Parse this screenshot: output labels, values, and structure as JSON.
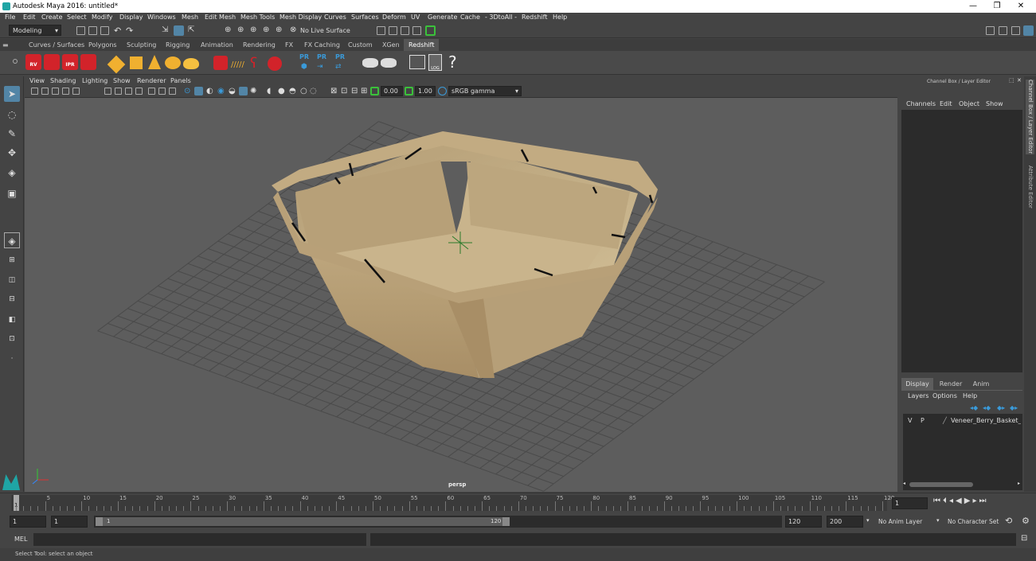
{
  "window": {
    "title": "Autodesk Maya 2016: untitled*",
    "minimize": "—",
    "restore": "❐",
    "close": "✕"
  },
  "menus": [
    "File",
    "Edit",
    "Create",
    "Select",
    "Modify",
    "Display",
    "Windows",
    "Mesh",
    "Edit Mesh",
    "Mesh Tools",
    "Mesh Display",
    "Curves",
    "Surfaces",
    "Deform",
    "UV",
    "Generate",
    "Cache",
    "- 3DtoAll -",
    "Redshift",
    "Help"
  ],
  "statusline": {
    "mode": "Modeling",
    "live_surface": "No Live Surface"
  },
  "shelf_tabs": [
    "Curves / Surfaces",
    "Polygons",
    "Sculpting",
    "Rigging",
    "Animation",
    "Rendering",
    "FX",
    "FX Caching",
    "Custom",
    "XGen",
    "Redshift"
  ],
  "shelf_active": "Redshift",
  "shelf_labels": {
    "rv": "RV",
    "ipr": "IPR",
    "pr": "PR",
    "log": "LOG",
    "help": "?"
  },
  "panel_menu": [
    "View",
    "Shading",
    "Lighting",
    "Show",
    "Renderer",
    "Panels"
  ],
  "panel_toolbar": {
    "exposure": "0.00",
    "gamma": "1.00",
    "colorspace": "sRGB gamma"
  },
  "viewport": {
    "camera_label": "persp"
  },
  "channel_box": {
    "title": "Channel Box / Layer Editor",
    "menus": [
      "Channels",
      "Edit",
      "Object",
      "Show"
    ],
    "layer_tabs": [
      "Display",
      "Render",
      "Anim"
    ],
    "layer_tab_active": "Display",
    "layer_menus": [
      "Layers",
      "Options",
      "Help"
    ],
    "layer_row": {
      "v": "V",
      "p": "P",
      "name": "Veneer_Berry_Basket_Squ"
    }
  },
  "side_tabs": [
    "Channel Box / Layer Editor",
    "Attribute Editor"
  ],
  "timeline": {
    "ticks": [
      "5",
      "10",
      "15",
      "20",
      "25",
      "30",
      "35",
      "40",
      "45",
      "50",
      "55",
      "60",
      "65",
      "70",
      "75",
      "80",
      "85",
      "90",
      "95",
      "100",
      "105",
      "110",
      "115",
      "120"
    ],
    "start_mark": "1",
    "current_frame": "1"
  },
  "range": {
    "start": "1",
    "playback_start": "1",
    "slider_start": "1",
    "slider_end": "120",
    "playback_end": "120",
    "end": "200",
    "anim_layer": "No Anim Layer",
    "char_set": "No Character Set"
  },
  "cmd": {
    "label": "MEL"
  },
  "help": {
    "text": "Select Tool: select an object"
  },
  "colors": {
    "accent": "#5285a6",
    "shelf_red": "#d2232a",
    "shelf_yellow": "#f0b030",
    "shelf_blue": "#3a9ad9",
    "basket": "#b8a27a"
  }
}
